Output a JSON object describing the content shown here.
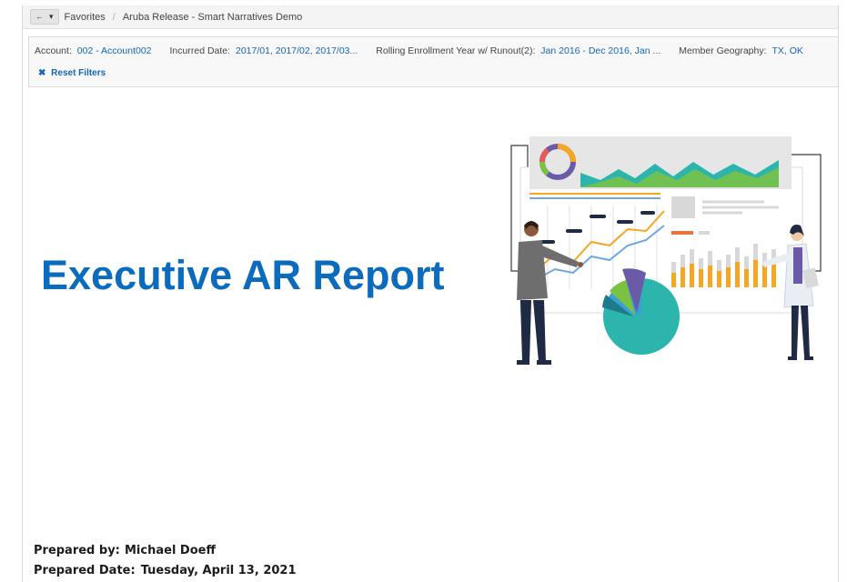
{
  "nav": {
    "back_glyph": "←",
    "dropdown_glyph": "▾",
    "breadcrumb": [
      "Favorites",
      "Aruba Release - Smart Narratives Demo"
    ],
    "separator": "/"
  },
  "filters": [
    {
      "label": "Account:",
      "value": "002 - Account002"
    },
    {
      "label": "Incurred Date:",
      "value": "2017/01, 2017/02, 2017/03..."
    },
    {
      "label": "Rolling Enrollment Year w/ Runout(2):",
      "value": "Jan 2016 - Dec 2016, Jan ..."
    },
    {
      "label": "Member Geography:",
      "value": "TX, OK"
    }
  ],
  "reset": {
    "icon": "✖",
    "label": "Reset Filters"
  },
  "report": {
    "title": "Executive AR Report"
  },
  "footer": {
    "prepared_by_label": "Prepared by:",
    "prepared_by_value": "Michael Doeff",
    "prepared_date_label": "Prepared Date:",
    "prepared_date_value": "Tuesday, April 13, 2021"
  },
  "colors": {
    "accent": "#0b6bbd",
    "link": "#1565b3",
    "illustration_teal": "#2bb5ad",
    "illustration_orange": "#f5a623",
    "illustration_purple": "#6a5aa8"
  }
}
